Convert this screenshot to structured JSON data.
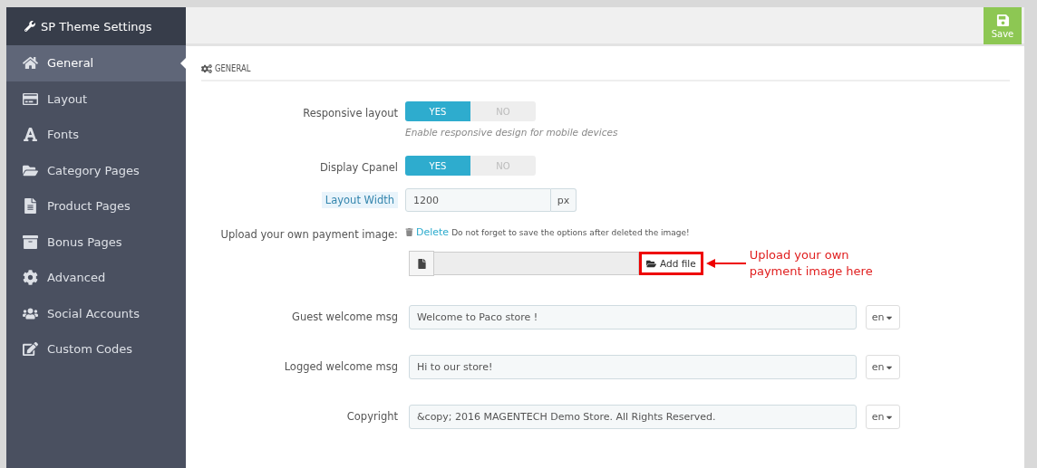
{
  "sidebar": {
    "title": "SP Theme Settings",
    "items": [
      {
        "label": "General",
        "selected": true
      },
      {
        "label": "Layout",
        "selected": false
      },
      {
        "label": "Fonts",
        "selected": false
      },
      {
        "label": "Category Pages",
        "selected": false
      },
      {
        "label": "Product Pages",
        "selected": false
      },
      {
        "label": "Bonus Pages",
        "selected": false
      },
      {
        "label": "Advanced",
        "selected": false
      },
      {
        "label": "Social Accounts",
        "selected": false
      },
      {
        "label": "Custom Codes",
        "selected": false
      }
    ]
  },
  "toolbar": {
    "save": "Save"
  },
  "panel": {
    "heading": "GENERAL",
    "fields": [
      {
        "kind": "toggle",
        "label": "Responsive layout",
        "options": [
          {
            "label": "YES",
            "selected": true
          },
          {
            "label": "NO",
            "selected": false
          }
        ],
        "hint": "Enable responsive design for mobile devices"
      },
      {
        "kind": "toggle",
        "label": "Display Cpanel",
        "options": [
          {
            "label": "YES",
            "selected": true
          },
          {
            "label": "NO",
            "selected": false
          }
        ]
      },
      {
        "kind": "addon",
        "label": "Layout Width",
        "value": "1200",
        "suffix": "px"
      },
      {
        "kind": "upload",
        "label": "Upload your own payment image:",
        "delete_link": "Delete",
        "delete_note": "Do not forget to save the options after deleted the image!",
        "button": "Add file",
        "annotation": "Upload your own payment image here"
      },
      {
        "kind": "text",
        "label": "Guest welcome msg",
        "value": "Welcome to Paco store !",
        "language": "en"
      },
      {
        "kind": "text",
        "label": "Logged welcome msg",
        "value": "Hi to our store!",
        "language": "en"
      },
      {
        "kind": "text",
        "label": "Copyright",
        "value": "&copy; 2016 MAGENTECH Demo Store. All Rights Reserved.",
        "language": "en"
      }
    ]
  }
}
